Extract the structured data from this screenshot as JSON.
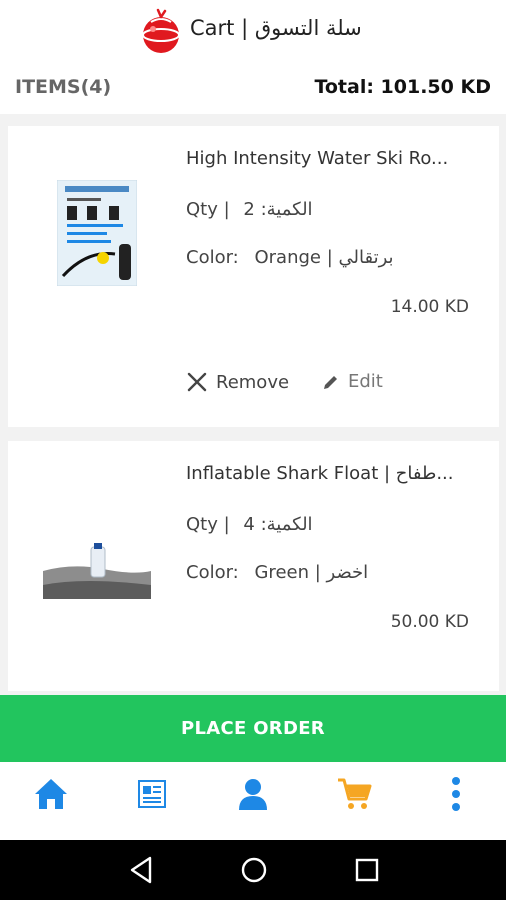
{
  "header": {
    "title": "Cart | سلة التسوق"
  },
  "summary": {
    "items_label": "ITEMS(4)",
    "total_label": "Total: 101.50 KD"
  },
  "cart_items": [
    {
      "name": "High Intensity Water Ski Ro...",
      "qty_label": "Qty | الكمية:",
      "qty": "2",
      "color_label": "Color:",
      "color": "Orange | برتقالي",
      "price": "14.00 KD",
      "remove_label": "Remove",
      "edit_label": "Edit"
    },
    {
      "name": "Inflatable Shark Float | طفاح...",
      "qty_label": "Qty | الكمية:",
      "qty": "4",
      "color_label": "Color:",
      "color": "Green | اخضر",
      "price": "50.00 KD"
    }
  ],
  "place_order": {
    "label": "PLACE ORDER"
  },
  "bottom_nav": {
    "items": [
      {
        "icon": "home-icon",
        "color": "#1e88e5"
      },
      {
        "icon": "catalog-icon",
        "color": "#1e88e5"
      },
      {
        "icon": "user-icon",
        "color": "#1e88e5"
      },
      {
        "icon": "cart-icon",
        "color": "#f5a623"
      },
      {
        "icon": "more-vertical-icon",
        "color": "#1e88e5"
      }
    ]
  },
  "colors": {
    "accent": "#22c55e",
    "nav_blue": "#1e88e5",
    "nav_active": "#f5a623"
  }
}
